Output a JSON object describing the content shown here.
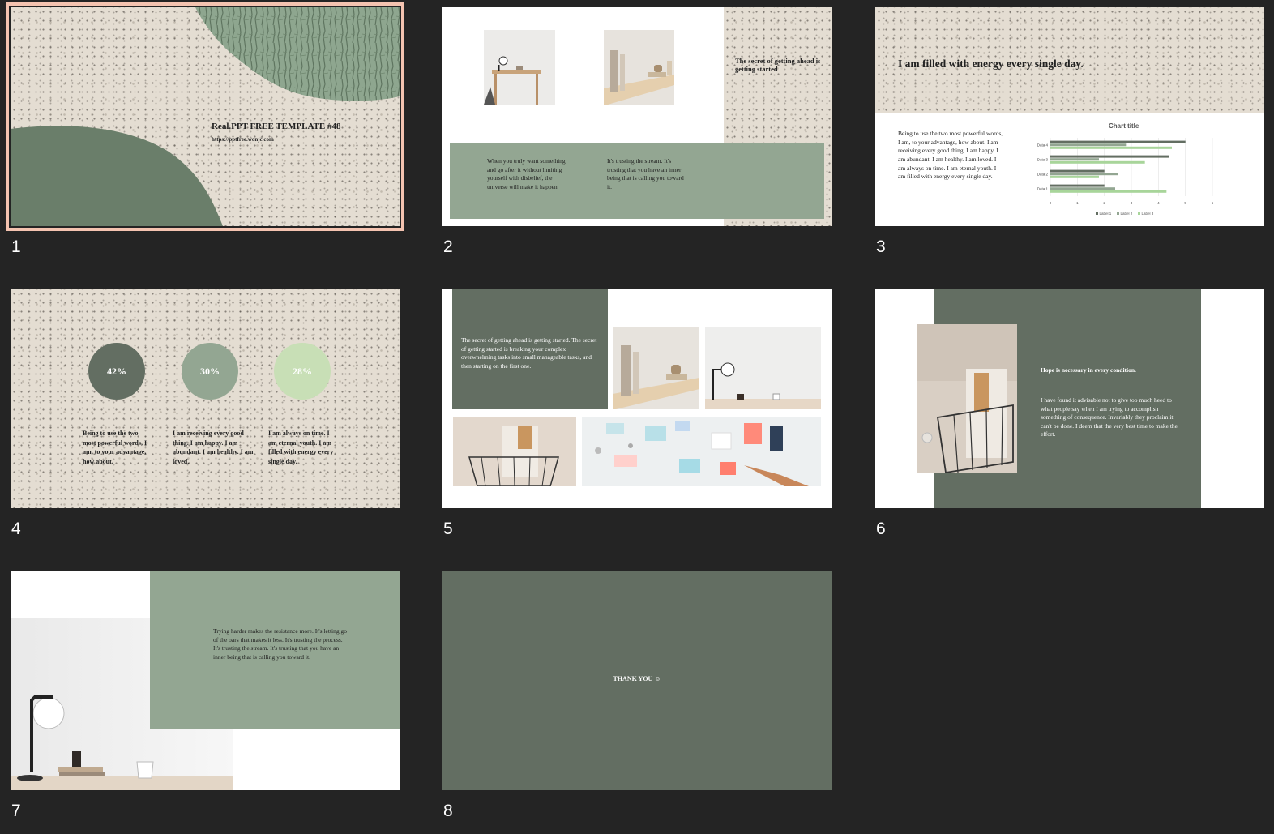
{
  "colors": {
    "panel_bg": "#242424",
    "sage_dark": "#636e62",
    "sage_mid": "#93a692",
    "sage_light": "#c8dfb6",
    "beige": "#e4ddd2",
    "selection": "#f4c3b0"
  },
  "slides": [
    {
      "number": "1",
      "selected": true,
      "title": "Real.PPT FREE TEMPLATE #48",
      "url": "https://pptfree.wonjc.com"
    },
    {
      "number": "2",
      "heading": "The secret of getting ahead is getting started",
      "text_left": "When you truly want something and go after it without limiting yourself with disbelief, the universe will make it happen.",
      "text_right": "It's trusting the stream. It's trusting that you have an inner being that is calling you toward it."
    },
    {
      "number": "3",
      "heading": "I am filled with energy every single day.",
      "body": "Being to use the two most powerful words, I am, to your advantage, how about. I am receiving every good thing. I am happy. I am abundant. I am healthy. I am loved. I am always on time. I am eternal youth. I am filled with energy every single day."
    },
    {
      "number": "4",
      "circles": [
        {
          "label": "42%",
          "color": "#636e62"
        },
        {
          "label": "30%",
          "color": "#93a692"
        },
        {
          "label": "28%",
          "color": "#c8dfb6"
        }
      ],
      "texts": [
        "Being to use the two most powerful words, I am, to your advantage, how about.",
        "I am receiving every good thing. I am happy. I am abundant. I am healthy. I am loved.",
        "I am always on time. I am eternal youth. I am filled with energy every single day."
      ]
    },
    {
      "number": "5",
      "text": "The secret of getting ahead is getting started. The secret of getting started is breaking your complex overwhelming tasks into small manageable tasks, and then starting on the first one."
    },
    {
      "number": "6",
      "heading": "Hope is necessary in every condition.",
      "body": "I have found it advisable not to give too much heed to what people say when I am trying to accomplish something of consequence. Invariably they proclaim it can't be done. I deem that the very best time to make the effort."
    },
    {
      "number": "7",
      "body": "Trying harder makes the resistance more. It's letting go of the oars that makes it less. It's trusting the process. It's trusting the stream. It's trusting that you have an inner being that is calling you toward it."
    },
    {
      "number": "8",
      "text": "THANK YOU ☺"
    }
  ],
  "chart_data": {
    "type": "bar",
    "orientation": "horizontal",
    "title": "Chart title",
    "categories": [
      "Data 1",
      "Data 2",
      "Data 3",
      "Data 4"
    ],
    "series": [
      {
        "name": "Label 1",
        "color": "#636e62",
        "values": [
          2.0,
          2.0,
          4.4,
          5.0
        ]
      },
      {
        "name": "Label 2",
        "color": "#93a692",
        "values": [
          2.4,
          2.5,
          1.8,
          2.8
        ]
      },
      {
        "name": "Label 3",
        "color": "#a8d59a",
        "values": [
          4.3,
          1.8,
          3.5,
          4.5
        ]
      }
    ],
    "xticks": [
      "0",
      "1",
      "2",
      "3",
      "4",
      "5",
      "6"
    ],
    "xlim": [
      0,
      6
    ],
    "legend_position": "bottom",
    "grid": true
  }
}
